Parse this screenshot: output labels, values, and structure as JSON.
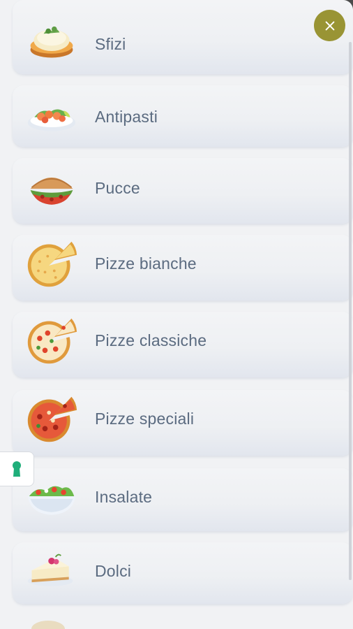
{
  "menu": {
    "items": [
      {
        "label": "Sfizi",
        "icon": "bruschetta-icon"
      },
      {
        "label": "Antipasti",
        "icon": "shrimp-plate-icon"
      },
      {
        "label": "Pucce",
        "icon": "sandwich-icon"
      },
      {
        "label": "Pizze bianche",
        "icon": "white-pizza-icon"
      },
      {
        "label": "Pizze classiche",
        "icon": "classic-pizza-icon"
      },
      {
        "label": "Pizze speciali",
        "icon": "special-pizza-icon"
      },
      {
        "label": "Insalate",
        "icon": "salad-bowl-icon"
      },
      {
        "label": "Dolci",
        "icon": "cheesecake-icon"
      }
    ]
  },
  "close_button": {
    "icon": "close-icon",
    "color": "#999434"
  },
  "accessibility_button": {
    "icon": "keyhole-icon",
    "color": "#1fae7a"
  },
  "colors": {
    "label": "#5b6b80",
    "background": "#f1f2f4"
  }
}
